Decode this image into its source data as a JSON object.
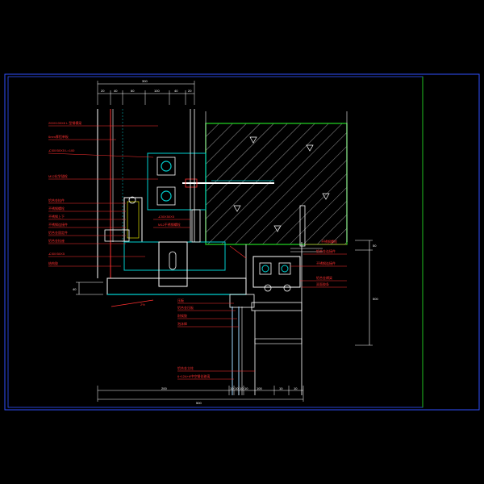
{
  "colors": {
    "background": "#000000",
    "frame": "#3050ff",
    "title_block_line": "#20c020",
    "label": "#ff3030",
    "dimension": "#ffffff",
    "steel": "#00d0d0",
    "concrete": "#20c020",
    "glass": "#a0d8ff",
    "accent": "#ffff00"
  },
  "icons": {
    "hatch": "concrete-hatch-icon",
    "bolt": "anchor-bolt-icon"
  },
  "labels_left": [
    "200X100X8 L 型钢横梁",
    "6mm厚铝单板",
    "∠50X50X5 L=100",
    "M12化学锚栓",
    "铝合金挂件",
    "不锈钢螺栓",
    "不锈钢上下",
    "不锈钢连接件",
    "铝合金固定件",
    "铝合金挂座",
    "∠50X50X5",
    "结构胶"
  ],
  "labels_mid": [
    "∠50X50X5",
    "M12不锈钢螺栓"
  ],
  "labels_bottom_left": [
    "压板",
    "铝合金压板",
    "耐候胶",
    "泡沫棒",
    "铝合金立柱",
    "6+12A+6中空钢化玻璃"
  ],
  "labels_right": [
    "不锈钢螺栓",
    "铝合金连接件",
    "不锈钢连接件",
    "铝合金横梁",
    "双面胶条"
  ],
  "dims_top": [
    "20",
    "40",
    "60",
    "100",
    "40",
    "20"
  ],
  "dim_top_total": "300",
  "dims_bottom": [
    "200",
    "10",
    "10",
    "10",
    "10",
    "100",
    "10",
    "10"
  ],
  "dim_bottom_total": "500",
  "dim_right": "50",
  "dim_right_total": "500",
  "dim_left": "40",
  "dim_slope": "2%"
}
